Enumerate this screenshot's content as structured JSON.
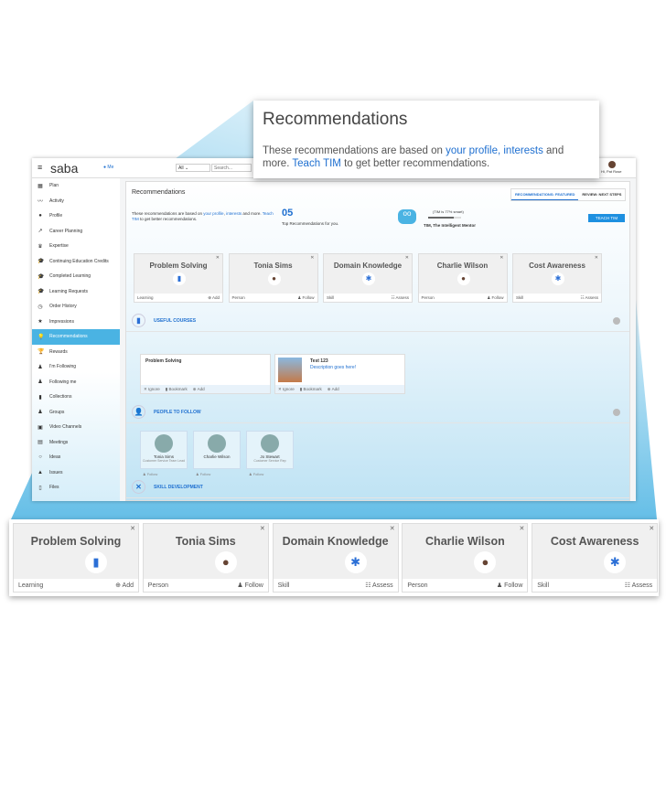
{
  "header": {
    "logo": "saba",
    "me": "Me",
    "filter": "All",
    "search_placeholder": "Search...",
    "user": "Hi, Pat Rose"
  },
  "sidebar": {
    "items": [
      {
        "label": "Plan",
        "icon": "plan-icon"
      },
      {
        "label": "Activity",
        "icon": "activity-icon"
      },
      {
        "label": "Profile",
        "icon": "profile-icon"
      },
      {
        "label": "Career Planning",
        "icon": "career-icon"
      },
      {
        "label": "Expertise",
        "icon": "crown-icon"
      },
      {
        "label": "Continuing Education Credits",
        "icon": "graduation-cap-icon"
      },
      {
        "label": "Completed Learning",
        "icon": "graduation-cap-icon"
      },
      {
        "label": "Learning Requests",
        "icon": "graduation-cap-icon"
      },
      {
        "label": "Order History",
        "icon": "history-icon"
      },
      {
        "label": "Impressions",
        "icon": "star-icon"
      },
      {
        "label": "Recommendations",
        "icon": "bulb-icon",
        "active": true
      },
      {
        "label": "Rewards",
        "icon": "trophy-icon"
      },
      {
        "label": "I'm Following",
        "icon": "following-icon"
      },
      {
        "label": "Following me",
        "icon": "followers-icon"
      },
      {
        "label": "Collections",
        "icon": "bookmark-icon"
      },
      {
        "label": "Groups",
        "icon": "groups-icon"
      },
      {
        "label": "Video Channels",
        "icon": "video-icon"
      },
      {
        "label": "Meetings",
        "icon": "calendar-icon"
      },
      {
        "label": "Ideas",
        "icon": "idea-icon"
      },
      {
        "label": "Issues",
        "icon": "warning-icon"
      },
      {
        "label": "Files",
        "icon": "file-icon"
      }
    ]
  },
  "main": {
    "title": "Recommendations",
    "tabs": [
      {
        "label": "RECOMMENDATIONS: FEATURED",
        "active": true
      },
      {
        "label": "REVIEW: NEXT STEPS"
      }
    ],
    "intro": {
      "prefix": "These recommendations are based on ",
      "link1": "your profile",
      "sep": ", ",
      "link2": "interests",
      "suffix": " and more.",
      "link3": "Teach TIM",
      "suffix2": " to get better recommendations."
    },
    "count": "05",
    "count_label": "Top Recommendations for you.",
    "tim": {
      "smart": "(TIM is 77% smart)",
      "progress": 77,
      "name": "TIM, The Intelligent Mentor",
      "button": "TEACH TIM"
    },
    "cards": [
      {
        "title": "Problem Solving",
        "type": "Learning",
        "action": "Add",
        "icon": "book-icon"
      },
      {
        "title": "Tonia Sims",
        "type": "Person",
        "action": "Follow",
        "icon": "avatar"
      },
      {
        "title": "Domain Knowledge",
        "type": "Skill",
        "action": "Assess",
        "icon": "tools-icon"
      },
      {
        "title": "Charlie Wilson",
        "type": "Person",
        "action": "Follow",
        "icon": "avatar"
      },
      {
        "title": "Cost Awareness",
        "type": "Skill",
        "action": "Assess",
        "icon": "tools-icon"
      }
    ],
    "useful_courses": {
      "label": "USEFUL COURSES",
      "courses": [
        {
          "title": "Problem Solving"
        },
        {
          "title": "Test 123",
          "desc": "Description goes here!"
        }
      ],
      "actions": [
        "Ignore",
        "Bookmark",
        "Add"
      ]
    },
    "people": {
      "label": "PEOPLE TO FOLLOW",
      "items": [
        {
          "name": "Tonia Sims",
          "role": "Customer Service Team Lead"
        },
        {
          "name": "Charlie Wilson",
          "role": ""
        },
        {
          "name": "Jo Stewart",
          "role": "Customer Service Rep"
        }
      ],
      "action": "Follow"
    },
    "skill_dev": {
      "label": "SKILL DEVELOPMENT"
    }
  },
  "callout": {
    "title": "Recommendations",
    "prefix": "These recommendations are based on ",
    "link1": "your profile, interests",
    "suffix": " and more.",
    "link2": "Teach TIM",
    "suffix2": " to get better recommendations."
  },
  "colors": {
    "accent": "#4ab3e3",
    "link": "#1e6fd0"
  }
}
